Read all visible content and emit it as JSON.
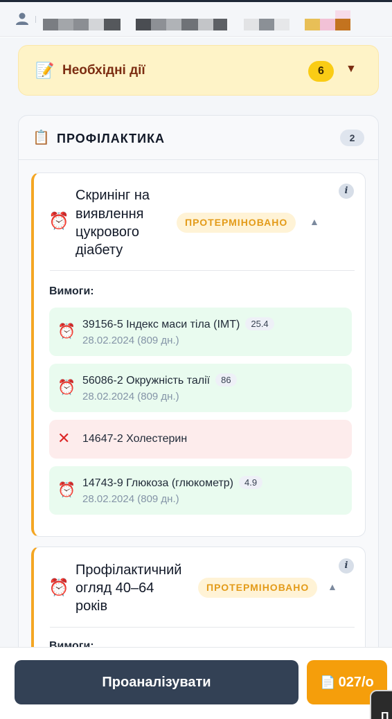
{
  "header": {
    "user_icon": "user-icon",
    "redacted": "redacted"
  },
  "actions": {
    "icon": "memo-icon",
    "label": "Необхідні дії",
    "count": "6",
    "chevron": "▼"
  },
  "section": {
    "icon": "clipboard-icon",
    "title": "ПРОФІЛАКТИКА",
    "count": "2",
    "cards": [
      {
        "title_lines": [
          "Скринінг на",
          "виявлення",
          "цукрового",
          "діабету"
        ],
        "status": "ПРОТЕРМІНОВАНО",
        "chevron": "▲",
        "info": "i",
        "requirements_label": "Вимоги:",
        "requirements": [
          {
            "status": "ok",
            "name": "39156-5 Індекс маси тіла (IMT)",
            "value": "25.4",
            "date": "28.02.2024 (809 дн.)"
          },
          {
            "status": "ok",
            "name": "56086-2 Окружність талії",
            "value": "86",
            "date": "28.02.2024 (809 дн.)"
          },
          {
            "status": "missing",
            "name": "14647-2 Холестерин",
            "value": "",
            "date": ""
          },
          {
            "status": "ok",
            "name": "14743-9 Глюкоза (глюкометр)",
            "value": "4.9",
            "date": "28.02.2024 (809 дн.)"
          }
        ]
      },
      {
        "title_lines": [
          "Профілактичний",
          "огляд 40–64",
          "років"
        ],
        "status": "ПРОТЕРМІНОВАНО",
        "chevron": "▲",
        "info": "i",
        "requirements_label": "Вимоги:"
      }
    ]
  },
  "footer": {
    "analyze_label": "Проаналізувати",
    "form_label": "027/о",
    "form_icon": "document-icon",
    "corner_text": "П"
  },
  "colors": {
    "accent": "#f59e0b",
    "primary_button": "#334155",
    "overdue_text": "#e39b19",
    "ok_bg": "#e9fbef",
    "missing_bg": "#fdecec"
  }
}
